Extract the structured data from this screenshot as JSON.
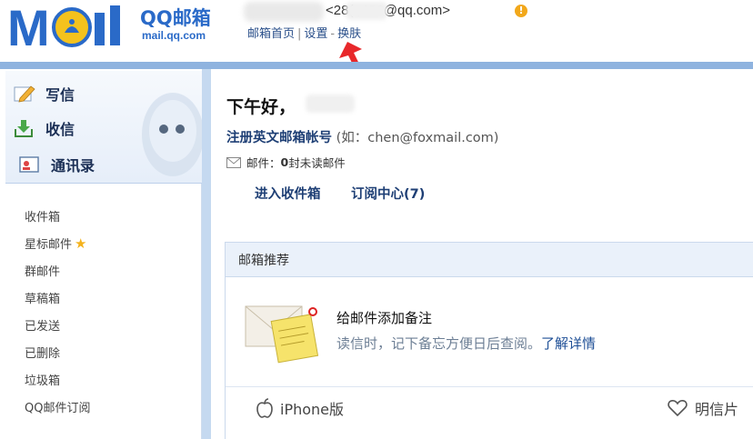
{
  "header": {
    "logo_text": "MOil",
    "qq_mail_title": "QQ邮箱",
    "domain": "mail.qq.com",
    "user_email": "<28(     ;436@qq.com>",
    "warn_symbol": "!",
    "nav": {
      "home": "邮箱首页",
      "sep1": "|",
      "settings": "设置",
      "sep2": "-",
      "skin": "换肤"
    }
  },
  "sidebar": {
    "quick": {
      "write": "写信",
      "inbox": "收信",
      "contacts": "通讯录"
    },
    "folders": [
      "收件箱",
      "星标邮件",
      "群邮件",
      "草稿箱",
      "已发送",
      "已删除",
      "垃圾箱",
      "QQ邮件订阅"
    ],
    "star_symbol": "★"
  },
  "main": {
    "greeting": "下午好，",
    "register_link": "注册英文邮箱帐号",
    "register_hint": "(如：chen@foxmail.com)",
    "mail_label": "邮件：",
    "unread_count": "0",
    "unread_text": " 封未读邮件",
    "enter_inbox": "进入收件箱",
    "subscribe": "订阅中心(7)",
    "recommend": {
      "header": "邮箱推荐",
      "note_title": "给邮件添加备注",
      "note_desc": "读信时，记下备忘方便日后查阅。",
      "note_link": "了解详情",
      "iphone": "iPhone版",
      "postcard": "明信片"
    }
  },
  "colors": {
    "accent_blue": "#2a6ac8",
    "frame_blue": "#8fb3df",
    "link_blue": "#1e3f75",
    "arrow_red": "#e8282b",
    "warn_orange": "#f2a81b"
  },
  "icons": [
    "moil-logo-icon",
    "warning-icon",
    "red-arrow-icon",
    "pencil-icon",
    "download-icon",
    "contacts-card-icon",
    "star-icon",
    "envelope-icon",
    "note-icon",
    "apple-icon",
    "heart-icon",
    "penguin-icon"
  ]
}
